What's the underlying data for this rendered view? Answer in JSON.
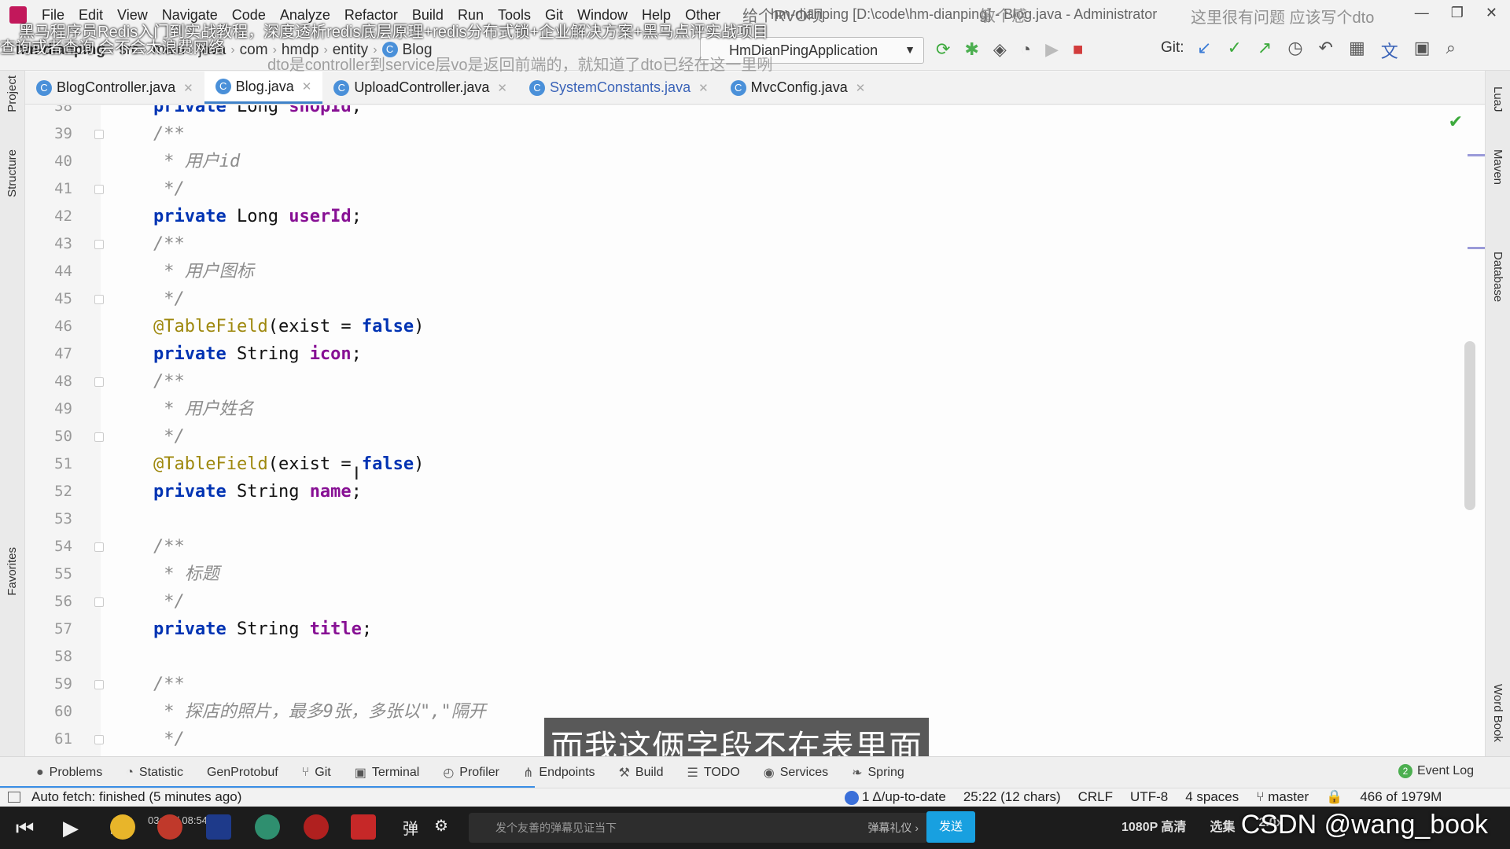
{
  "menu": {
    "items": [
      "File",
      "Edit",
      "View",
      "Navigate",
      "Code",
      "Analyze",
      "Refactor",
      "Build",
      "Run",
      "Tools",
      "Git",
      "Window",
      "Help",
      "Other"
    ],
    "window_title": "hm-dianping [D:\\code\\hm-dianping] - Blog.java - Administrator"
  },
  "danmaku": {
    "top_banner": "黑马程序员Redis入门到实战教程，深度透析redis底层原理+redis分布式锁+企业解决方案+黑马点评实战项目",
    "comment_1": "给个RVO呗",
    "comment_2": "这里很有问题  应该写个dto",
    "comment_3": "查询或者查询 会不会太浪费网络",
    "comment_4": "dto是controller到service层vo是返回前端的，就知道了dto已经在这一里咧",
    "comment_5": "敏个感"
  },
  "navbar": {
    "breadcrumbs": [
      "hm-dianping",
      "src",
      "main",
      "java",
      "com",
      "hmdp",
      "entity",
      "Blog"
    ],
    "run_config": "HmDianPingApplication",
    "git_label": "Git:"
  },
  "tabs": [
    {
      "label": "BlogController.java"
    },
    {
      "label": "Blog.java"
    },
    {
      "label": "UploadController.java"
    },
    {
      "label": "SystemConstants.java"
    },
    {
      "label": "MvcConfig.java"
    }
  ],
  "sidebar": {
    "left": [
      "Project",
      "Structure",
      "Favorites"
    ],
    "right": [
      "LuaJ",
      "Maven",
      "Database",
      "Word Book"
    ]
  },
  "editor": {
    "lines": [
      {
        "n": "38",
        "t": "private Long shopId;"
      },
      {
        "n": "39",
        "t": "/**"
      },
      {
        "n": "40",
        "t": " * 用户id"
      },
      {
        "n": "41",
        "t": " */"
      },
      {
        "n": "42",
        "t": "private Long userId;"
      },
      {
        "n": "43",
        "t": "/**"
      },
      {
        "n": "44",
        "t": " * 用户图标"
      },
      {
        "n": "45",
        "t": " */"
      },
      {
        "n": "46",
        "t": "@TableField(exist = false)"
      },
      {
        "n": "47",
        "t": "private String icon;"
      },
      {
        "n": "48",
        "t": "/**"
      },
      {
        "n": "49",
        "t": " * 用户姓名"
      },
      {
        "n": "50",
        "t": " */"
      },
      {
        "n": "51",
        "t": "@TableField(exist = false)"
      },
      {
        "n": "52",
        "t": "private String name;"
      },
      {
        "n": "53",
        "t": ""
      },
      {
        "n": "54",
        "t": "/**"
      },
      {
        "n": "55",
        "t": " * 标题"
      },
      {
        "n": "56",
        "t": " */"
      },
      {
        "n": "57",
        "t": "private String title;"
      },
      {
        "n": "58",
        "t": ""
      },
      {
        "n": "59",
        "t": "/**"
      },
      {
        "n": "60",
        "t": " * 探店的照片，最多9张，多张以\",\"隔开"
      },
      {
        "n": "61",
        "t": " */"
      }
    ]
  },
  "subtitle": "而我这俩字段不在表里面",
  "toolwindows": [
    "Problems",
    "Statistic",
    "GenProtobuf",
    "Git",
    "Terminal",
    "Profiler",
    "Endpoints",
    "Build",
    "TODO",
    "Services",
    "Spring"
  ],
  "event_log": {
    "count": "2",
    "label": "Event Log"
  },
  "status": {
    "message": "Auto fetch: finished (5 minutes ago)",
    "vcs": "1 Δ/up-to-date",
    "position": "25:22 (12 chars)",
    "line_sep": "CRLF",
    "encoding": "UTF-8",
    "indent": "4 spaces",
    "branch": "master",
    "memory": "466 of 1979M"
  },
  "player": {
    "time": "03:08 / 08:54",
    "danmu_placeholder": "发个友善的弹幕见证当下",
    "gift": "弹幕礼仪 ›",
    "send": "发送",
    "quality": "1080P 高清",
    "episodes": "选集",
    "speed": "2.0x",
    "watermark": "CSDN @wang_book"
  },
  "colors": {
    "accent": "#4083c9",
    "keyword": "#0033b3",
    "field": "#871094",
    "annotation": "#9e880d",
    "send_button": "#18a0e0"
  }
}
